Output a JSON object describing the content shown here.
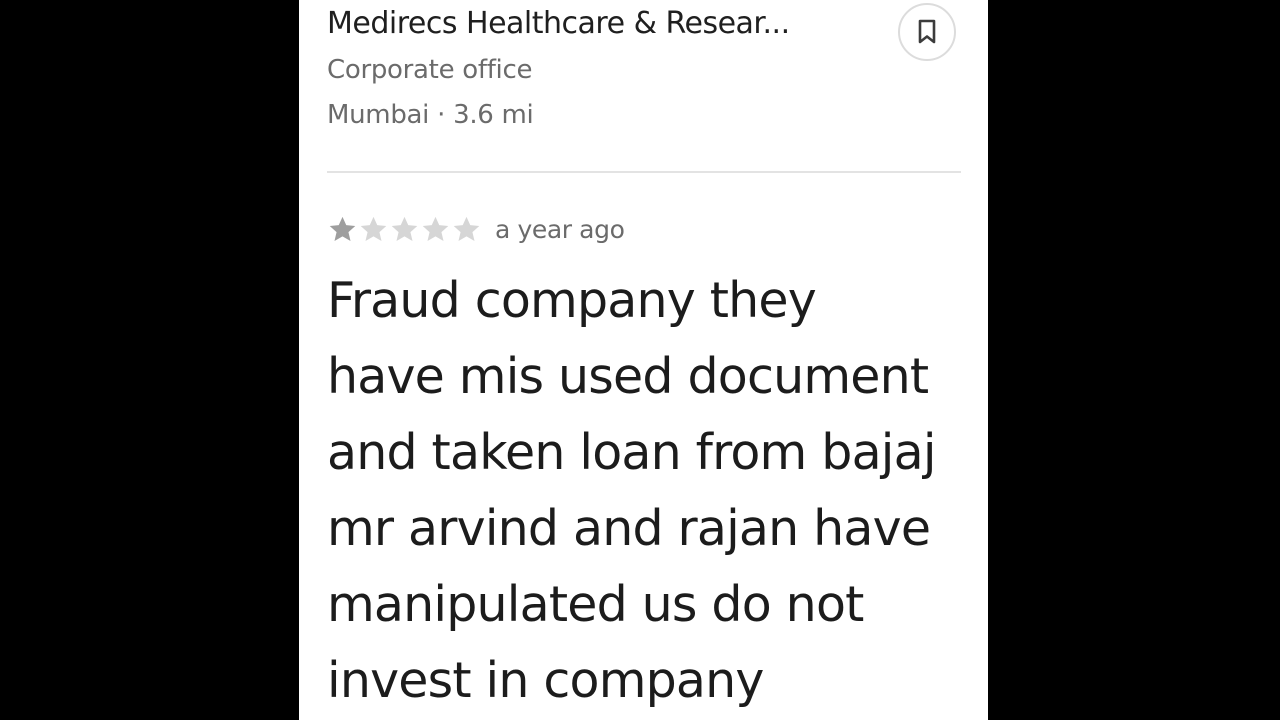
{
  "place": {
    "name": "Medirecs Healthcare & Resear...",
    "category": "Corporate office",
    "location": "Mumbai",
    "separator": "·",
    "distance": "3.6 mi"
  },
  "save_button": {
    "icon": "bookmark-icon"
  },
  "review": {
    "rating": 1,
    "max_rating": 5,
    "date": "a year ago",
    "text_lines": [
      "Fraud company they",
      "have mis used document",
      "and taken loan from bajaj",
      "mr arvind and rajan have",
      "manipulated us do not",
      "invest in company"
    ]
  },
  "colors": {
    "background": "#000000",
    "panel": "#ffffff",
    "primary_text": "#1f1f1f",
    "secondary_text": "#6b6b6b",
    "star_filled": "#9e9e9e",
    "star_empty": "#d6d6d6",
    "divider": "#e3e3e3"
  }
}
